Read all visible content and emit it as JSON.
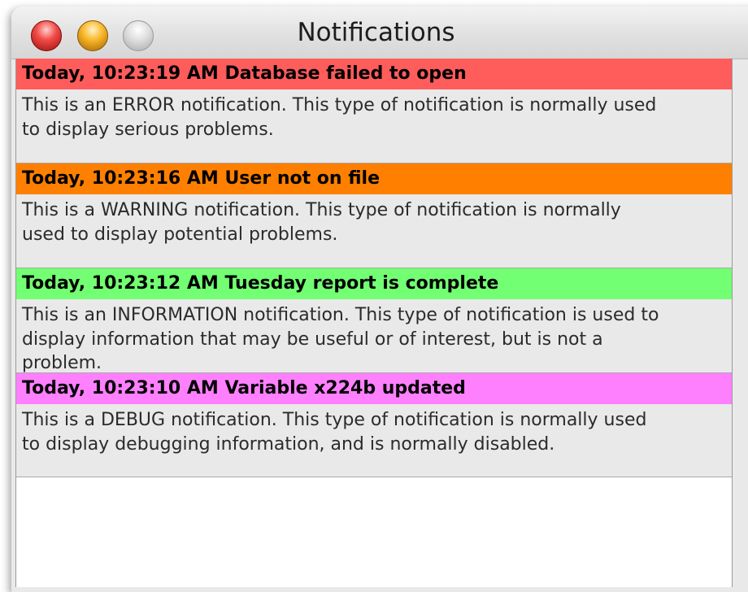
{
  "window": {
    "title": "Notifications"
  },
  "colors": {
    "error": "#ff5c5c",
    "warning": "#ff8000",
    "information": "#73ff73",
    "debug": "#ff80ff"
  },
  "notifications": [
    {
      "level": "error",
      "header": "Today, 10:23:19 AM Database failed to open",
      "body": "This is an ERROR notification. This type of notification is normally used\nto display serious problems."
    },
    {
      "level": "warning",
      "header": "Today, 10:23:16 AM User not on file",
      "body": "This is a WARNING notification. This type of notification is normally\nused to display potential problems."
    },
    {
      "level": "information",
      "header": "Today, 10:23:12 AM Tuesday report is complete",
      "body": "This is an INFORMATION notification. This type of notification is used to\ndisplay information that may be useful or of interest, but is not a\nproblem."
    },
    {
      "level": "debug",
      "header": "Today, 10:23:10 AM Variable x224b updated",
      "body": "This is a DEBUG notification. This type of notification is normally used\nto display debugging information, and is normally disabled."
    }
  ]
}
